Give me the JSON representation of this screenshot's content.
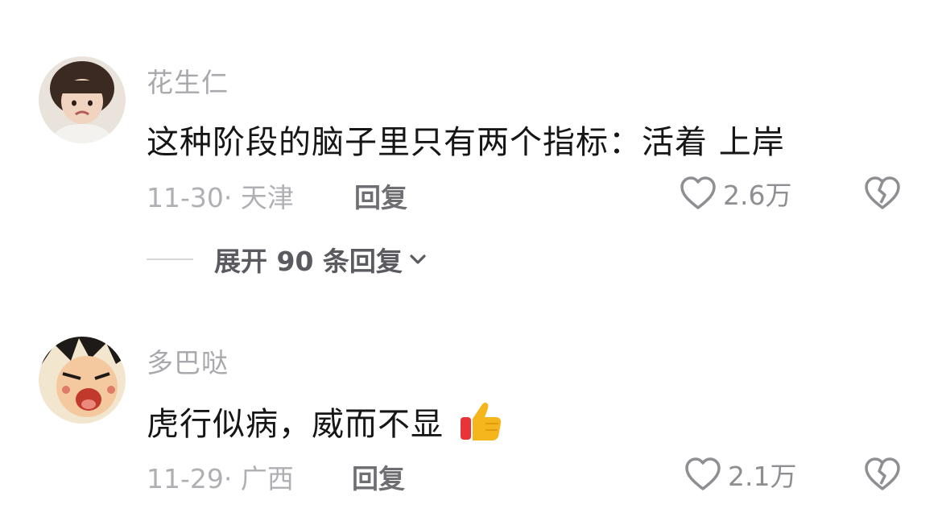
{
  "comments": [
    {
      "username": "花生仁",
      "text": "这种阶段的脑子里只有两个指标：活着 上岸",
      "date_location": "11-30· 天津",
      "reply_label": "回复",
      "like_count": "2.6万"
    },
    {
      "username": "多巴哒",
      "text": "虎行似病，威而不显",
      "date_location": "11-29· 广西",
      "reply_label": "回复",
      "like_count": "2.1万"
    }
  ],
  "expand_replies_label": "展开 90 条回复",
  "icons": {
    "like": "heart-outline-icon",
    "dislike": "broken-heart-icon",
    "expand": "chevron-down-icon",
    "thumbs_up": "thumbs-up-emoji"
  },
  "colors": {
    "username": "#a9a9ad",
    "text": "#161616",
    "meta": "#b0b0b4",
    "reply": "#6e6e73"
  }
}
